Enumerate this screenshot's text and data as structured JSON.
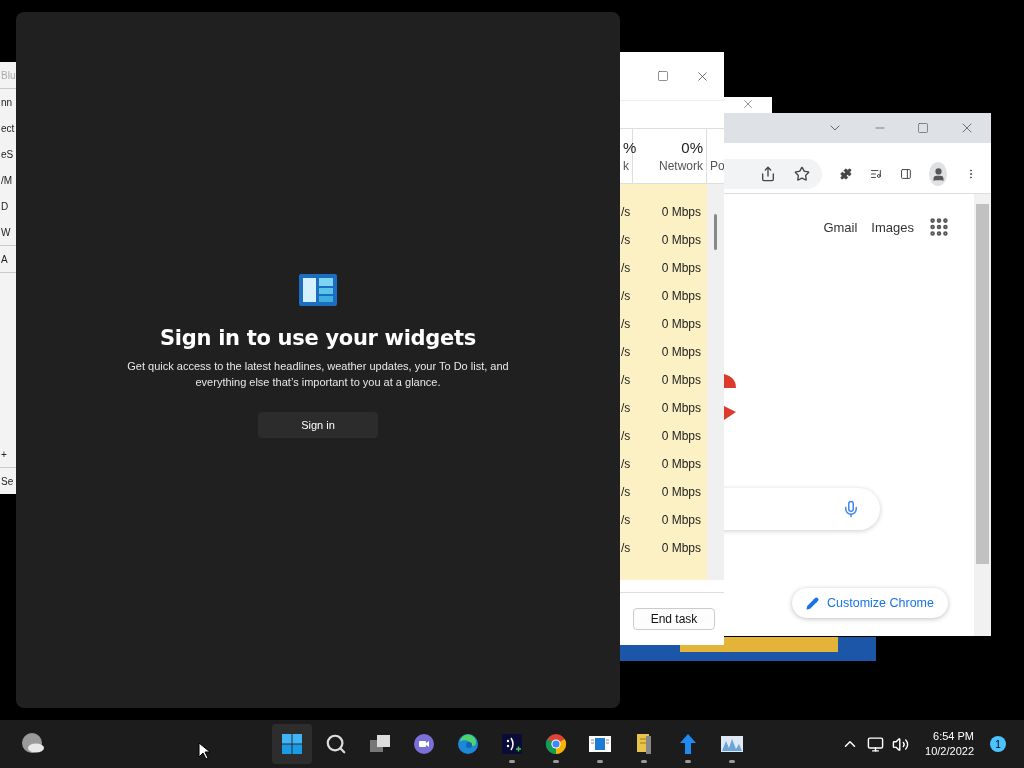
{
  "left_window": {
    "fragments": [
      "Blu",
      "nn",
      "ect",
      "eS",
      "/M",
      "D",
      "W",
      "A",
      "+",
      "Se"
    ]
  },
  "widgets": {
    "title": "Sign in to use your widgets",
    "description": "Get quick access to the latest headlines, weather updates, your To Do list, and everything else that’s important to you at a glance.",
    "button": "Sign in"
  },
  "task_manager": {
    "columns": [
      {
        "percent": "%",
        "name": "k"
      },
      {
        "percent": "0%",
        "name": "Network"
      },
      {
        "name": "Po"
      }
    ],
    "rows": [
      {
        "column_1": "/s",
        "network": "0 Mbps"
      },
      {
        "column_1": "/s",
        "network": "0 Mbps"
      },
      {
        "column_1": "/s",
        "network": "0 Mbps"
      },
      {
        "column_1": "/s",
        "network": "0 Mbps"
      },
      {
        "column_1": "/s",
        "network": "0 Mbps"
      },
      {
        "column_1": "/s",
        "network": "0 Mbps"
      },
      {
        "column_1": "/s",
        "network": "0 Mbps"
      },
      {
        "column_1": "/s",
        "network": "0 Mbps"
      },
      {
        "column_1": "/s",
        "network": "0 Mbps"
      },
      {
        "column_1": "/s",
        "network": "0 Mbps"
      },
      {
        "column_1": "/s",
        "network": "0 Mbps"
      },
      {
        "column_1": "/s",
        "network": "0 Mbps"
      },
      {
        "column_1": "/s",
        "network": "0 Mbps"
      }
    ],
    "button": "End task"
  },
  "chrome": {
    "links": [
      "Gmail",
      "Images"
    ],
    "customize_button": "Customize Chrome"
  },
  "taskbar": {
    "apps": [
      {
        "kind": "start",
        "selected": true,
        "running": false
      },
      {
        "kind": "search",
        "selected": false,
        "running": false
      },
      {
        "kind": "taskview",
        "selected": false,
        "running": false
      },
      {
        "kind": "chat",
        "selected": false,
        "running": false
      },
      {
        "kind": "edge",
        "selected": false,
        "running": false
      },
      {
        "kind": "terminal",
        "selected": false,
        "running": true
      },
      {
        "kind": "chrome",
        "selected": false,
        "running": true
      },
      {
        "kind": "app",
        "selected": false,
        "running": true
      },
      {
        "kind": "archive",
        "selected": false,
        "running": true
      },
      {
        "kind": "upload",
        "selected": false,
        "running": true
      },
      {
        "kind": "monitor",
        "selected": false,
        "running": true
      }
    ],
    "clock": {
      "time": "6:54 PM",
      "date": "10/2/2022"
    },
    "notification_count": "1"
  }
}
